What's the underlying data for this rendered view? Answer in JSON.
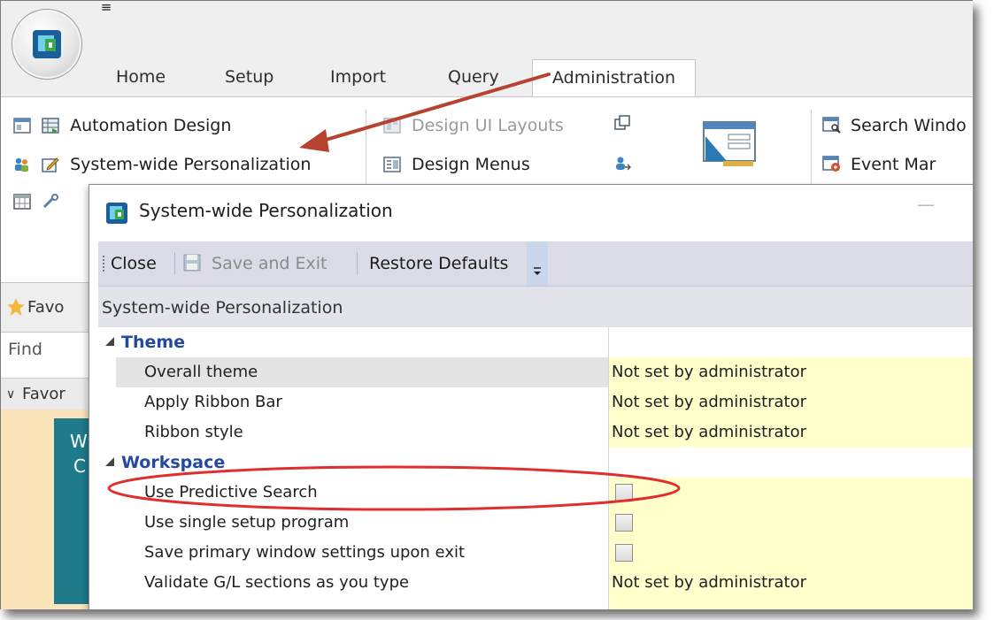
{
  "app": {
    "qat_glyph": "≡",
    "tabs": [
      "Home",
      "Setup",
      "Import",
      "Query",
      "Administration"
    ],
    "active_tab": "Administration"
  },
  "ribbon": {
    "automation_design": "Automation Design",
    "system_wide_personalization": "System-wide Personalization",
    "design_ui_layouts": "Design UI Layouts",
    "design_menus": "Design Menus",
    "search_windows": "Search Windo",
    "event_manager": "Event Mar"
  },
  "left_pane": {
    "favorites_label": "Favo",
    "find_placeholder": "Find",
    "favorites_row": "Favor",
    "teal_text_1": "W",
    "teal_text_2": "C"
  },
  "dialog": {
    "title": "System-wide Personalization",
    "minimize_glyph": "—",
    "toolbar": {
      "close": "Close",
      "save_and_exit": "Save and Exit",
      "restore_defaults": "Restore Defaults"
    },
    "grid_header": "System-wide Personalization",
    "rows": [
      {
        "type": "section",
        "name": "Theme",
        "value": ""
      },
      {
        "type": "item",
        "name": "Overall theme",
        "value": "Not set by administrator",
        "selected": true
      },
      {
        "type": "item",
        "name": "Apply Ribbon Bar",
        "value": "Not set by administrator"
      },
      {
        "type": "item",
        "name": "Ribbon style",
        "value": "Not set by administrator"
      },
      {
        "type": "section",
        "name": "Workspace",
        "value": ""
      },
      {
        "type": "checkbox",
        "name": "Use Predictive Search",
        "checked": false
      },
      {
        "type": "checkbox",
        "name": "Use single setup program",
        "checked": false
      },
      {
        "type": "checkbox",
        "name": "Save primary window settings upon exit",
        "checked": false
      },
      {
        "type": "item",
        "name": "Validate G/L sections as you type",
        "value": "Not set by administrator"
      }
    ]
  },
  "colors": {
    "annotation_red": "#e02d2d",
    "arrow": "#b5432f",
    "section_blue": "#244aa0",
    "value_yellow": "#ffffcc"
  }
}
